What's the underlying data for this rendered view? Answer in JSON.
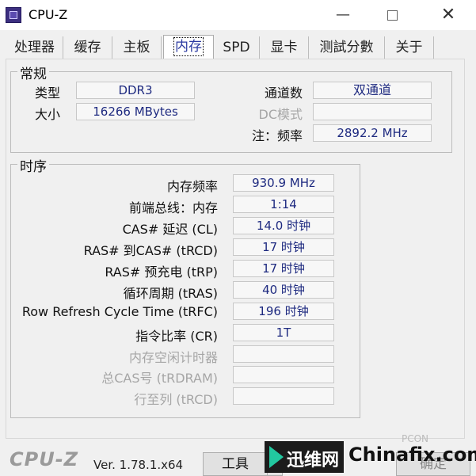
{
  "window": {
    "title": "CPU-Z",
    "minimize": "—",
    "close": "✕"
  },
  "tabs": [
    "处理器",
    "缓存",
    "主板",
    "内存",
    "SPD",
    "显卡",
    "测試分數",
    "关于"
  ],
  "general": {
    "title": "常规",
    "type_label": "类型",
    "type_value": "DDR3",
    "size_label": "大小",
    "size_value": "16266 MBytes",
    "channels_label": "通道数",
    "channels_value": "双通道",
    "dc_label": "DC模式",
    "dc_value": "",
    "freq_label": "注：频率",
    "freq_value": "2892.2 MHz"
  },
  "timings": {
    "title": "时序",
    "rows": [
      {
        "label": "内存频率",
        "value": "930.9 MHz",
        "disabled": false
      },
      {
        "label": "前端总线：内存",
        "value": "1:14",
        "disabled": false
      },
      {
        "label": "CAS# 延迟 (CL)",
        "value": "14.0 时钟",
        "disabled": false
      },
      {
        "label": "RAS# 到CAS# (tRCD)",
        "value": "17 时钟",
        "disabled": false
      },
      {
        "label": "RAS# 预充电 (tRP)",
        "value": "17 时钟",
        "disabled": false
      },
      {
        "label": "循环周期 (tRAS)",
        "value": "40 时钟",
        "disabled": false
      },
      {
        "label": "Row Refresh Cycle Time (tRFC)",
        "value": "196 时钟",
        "disabled": false
      },
      {
        "label": "指令比率 (CR)",
        "value": "1T",
        "disabled": false
      },
      {
        "label": "内存空闲计时器",
        "value": "",
        "disabled": true
      },
      {
        "label": "总CAS号 (tRDRAM)",
        "value": "",
        "disabled": true
      },
      {
        "label": "行至列 (tRCD)",
        "value": "",
        "disabled": true
      }
    ]
  },
  "footer": {
    "logo": "CPU-Z",
    "version": "Ver. 1.78.1.x64",
    "tools_label": "工具",
    "tools_arrow": "▼",
    "ok_label": "确定"
  },
  "watermark": {
    "badge": "迅维网",
    "site": "Chinafix.com",
    "pcon": "PCON"
  }
}
